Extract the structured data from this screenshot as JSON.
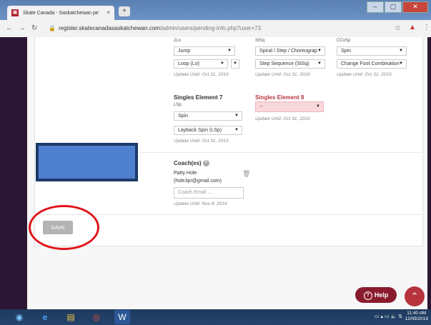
{
  "browser": {
    "tab_title": "Skate Canada - Saskatchewan pe",
    "favicon_glyph": "▣",
    "tab_close": "×",
    "new_tab": "+",
    "url_domain": "register.skatecanadasaskatchewan.com",
    "url_path": "/admin/users/pending-info.php?user=73",
    "window_controls": [
      "–",
      "▢",
      "✕"
    ]
  },
  "elements_top": {
    "col1": {
      "code": "2Lo",
      "type": "Jump",
      "element": "Loop (Lo)",
      "update": "Update Until: Oct 31, 2019"
    },
    "col2": {
      "code": "StSq",
      "type": "Spiral / Step / Choreograp",
      "element": "Step Sequence (StSq)",
      "update": "Update Until: Oct 31, 2019"
    },
    "col3": {
      "code": "CCoSp",
      "type": "Spin",
      "element": "Change Foot Combination",
      "update": "Update Until: Oct 31, 2019"
    }
  },
  "element7": {
    "title": "Singles Element 7",
    "code": "LSp",
    "type": "Spin",
    "element": "Layback Spin (LSp)",
    "update": "Update Until: Oct 31, 2019"
  },
  "element8": {
    "title": "Singles Element 8",
    "value": "--",
    "update": "Update Until: Oct 31, 2019"
  },
  "coach": {
    "title": "Coach(es)",
    "help_glyph": "?",
    "name": "Patty Hole",
    "email": "(hole3pr@gmail.com)",
    "email_placeholder": "Coach Email ...",
    "update": "Update Until: Nov 8, 2019"
  },
  "actions": {
    "save_label": "SAVE",
    "help_label": "Help",
    "help_glyph": "?",
    "up_glyph": "⌃"
  },
  "taskbar": {
    "time": "11:40 AM",
    "date": "12/09/2019"
  },
  "colors": {
    "brand": "#8a1b2e",
    "accent_red": "#b7343e",
    "error_bg": "#f8d7da",
    "annotation_ring": "#e0161c",
    "redaction_box": "#4f7fcf"
  }
}
